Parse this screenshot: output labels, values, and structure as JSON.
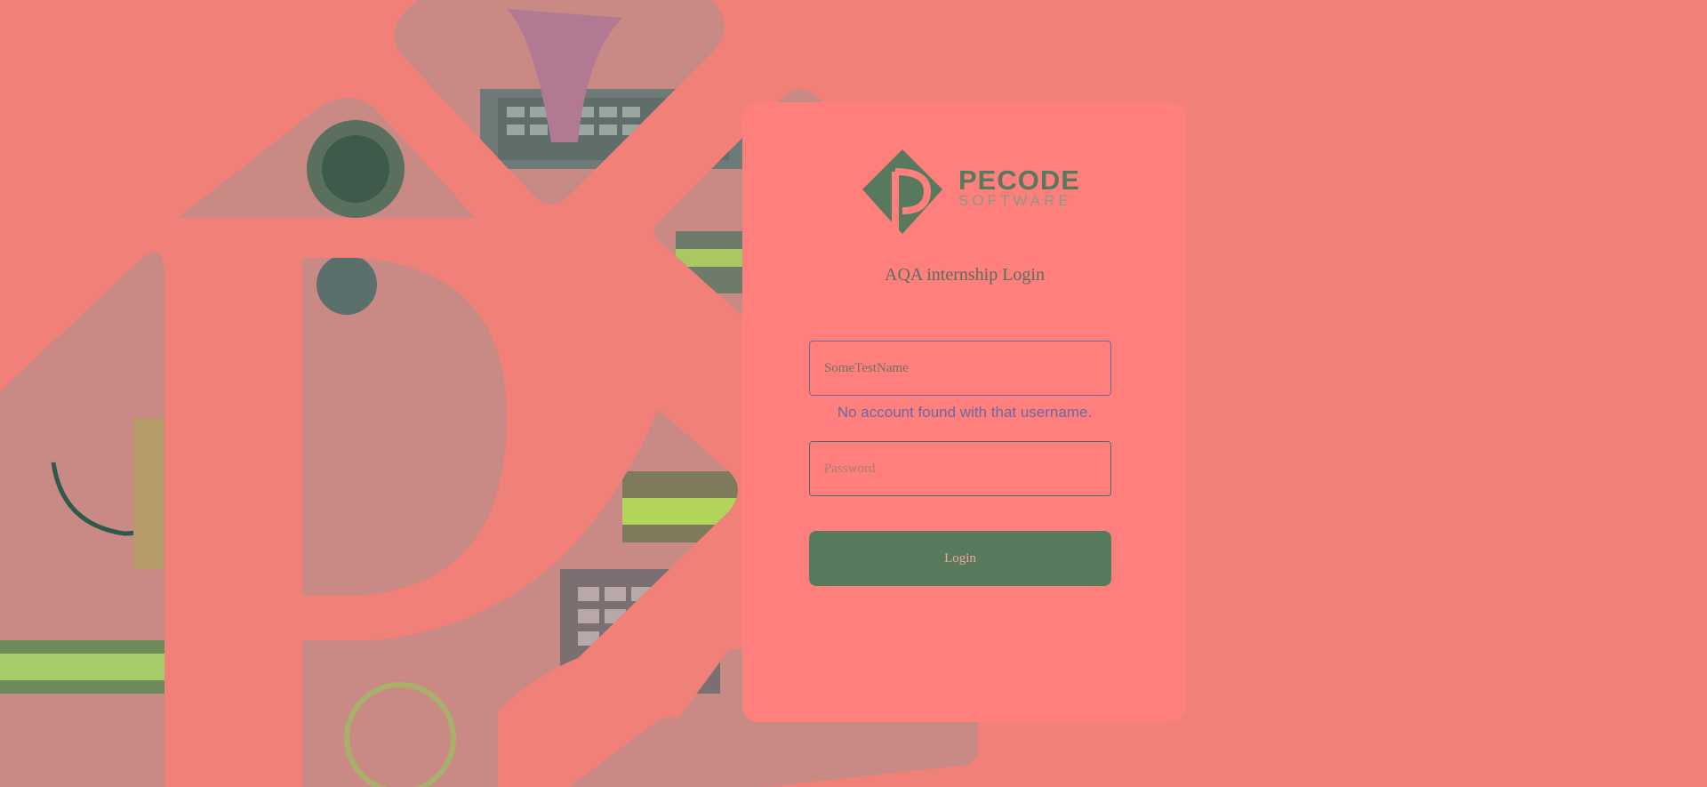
{
  "brand": {
    "name_top": "PECODE",
    "name_bottom": "SOFTWARE",
    "logo_icon": "pecode-diamond-logo-icon"
  },
  "login": {
    "title": "AQA internship Login",
    "username_value": "SomeTestName",
    "error_message": "No account found with that username.",
    "password_placeholder": "Password",
    "button_label": "Login"
  },
  "colors": {
    "page_background": "#f08078",
    "card_background": "#ff7f7c",
    "brand_green": "#567a5b",
    "error_text": "#6b68a8"
  }
}
